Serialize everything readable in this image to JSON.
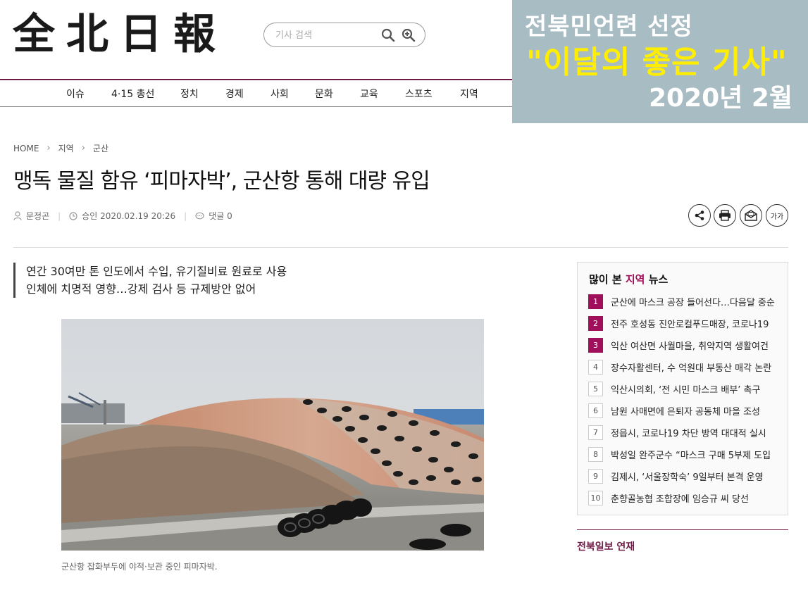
{
  "site": {
    "logo": [
      "全",
      "北",
      "日",
      "報"
    ],
    "search_placeholder": "기사 검색"
  },
  "nav": [
    "이슈",
    "4·15 총선",
    "정치",
    "경제",
    "사회",
    "문화",
    "교육",
    "스포츠",
    "지역"
  ],
  "banner": {
    "line1": "전북민언련 선정",
    "line2": "\"이달의 좋은 기사\"",
    "line3": "2020년 2월"
  },
  "breadcrumb": [
    "HOME",
    "지역",
    "군산"
  ],
  "article": {
    "title": "맹독 물질 함유 ‘피마자박’, 군산항 통해 대량 유입",
    "author": "문정곤",
    "approved": "승인 2020.02.19 20:26",
    "comments": "댓글 0",
    "subheads": [
      "연간 30여만 톤 인도에서 수입, 유기질비료 원료로 사용",
      "인체에 치명적 영향…강제 검사 등 규제방안 없어"
    ],
    "caption": "군산항 잡화부두에 야적·보관 중인 피마자박."
  },
  "tools": {
    "fontsize_label": "가가"
  },
  "sidebar": {
    "title_pre": "많이 본 ",
    "title_hl": "지역",
    "title_post": " 뉴스",
    "items": [
      {
        "num": "1",
        "text": "군산에 마스크 공장 들어선다…다음달 중순"
      },
      {
        "num": "2",
        "text": "전주 호성동 진안로컬푸드매장, 코로나19"
      },
      {
        "num": "3",
        "text": "익산 여산면 사월마을, 취약지역 생활여건"
      },
      {
        "num": "4",
        "text": "장수자활센터, 수 억원대 부동산 매각 논란"
      },
      {
        "num": "5",
        "text": "익산시의회, ‘전 시민 마스크 배부’ 촉구"
      },
      {
        "num": "6",
        "text": "남원 사매면에 은퇴자 공동체 마을 조성"
      },
      {
        "num": "7",
        "text": "정읍시, 코로나19 차단 방역 대대적 실시"
      },
      {
        "num": "8",
        "text": "박성일 완주군수 “마스크 구매 5부제 도입"
      },
      {
        "num": "9",
        "text": "김제시, ‘서울장학숙’ 9일부터 본격 운영"
      },
      {
        "num": "10",
        "text": "춘향골농협 조합장에 임승규 씨 당선"
      }
    ],
    "series_title": "전북일보 연재"
  },
  "colors": {
    "accent": "#a0105a",
    "nav_line": "#6d1a45",
    "banner_bg": "#a8bcc3",
    "banner_highlight": "#ffee00"
  }
}
